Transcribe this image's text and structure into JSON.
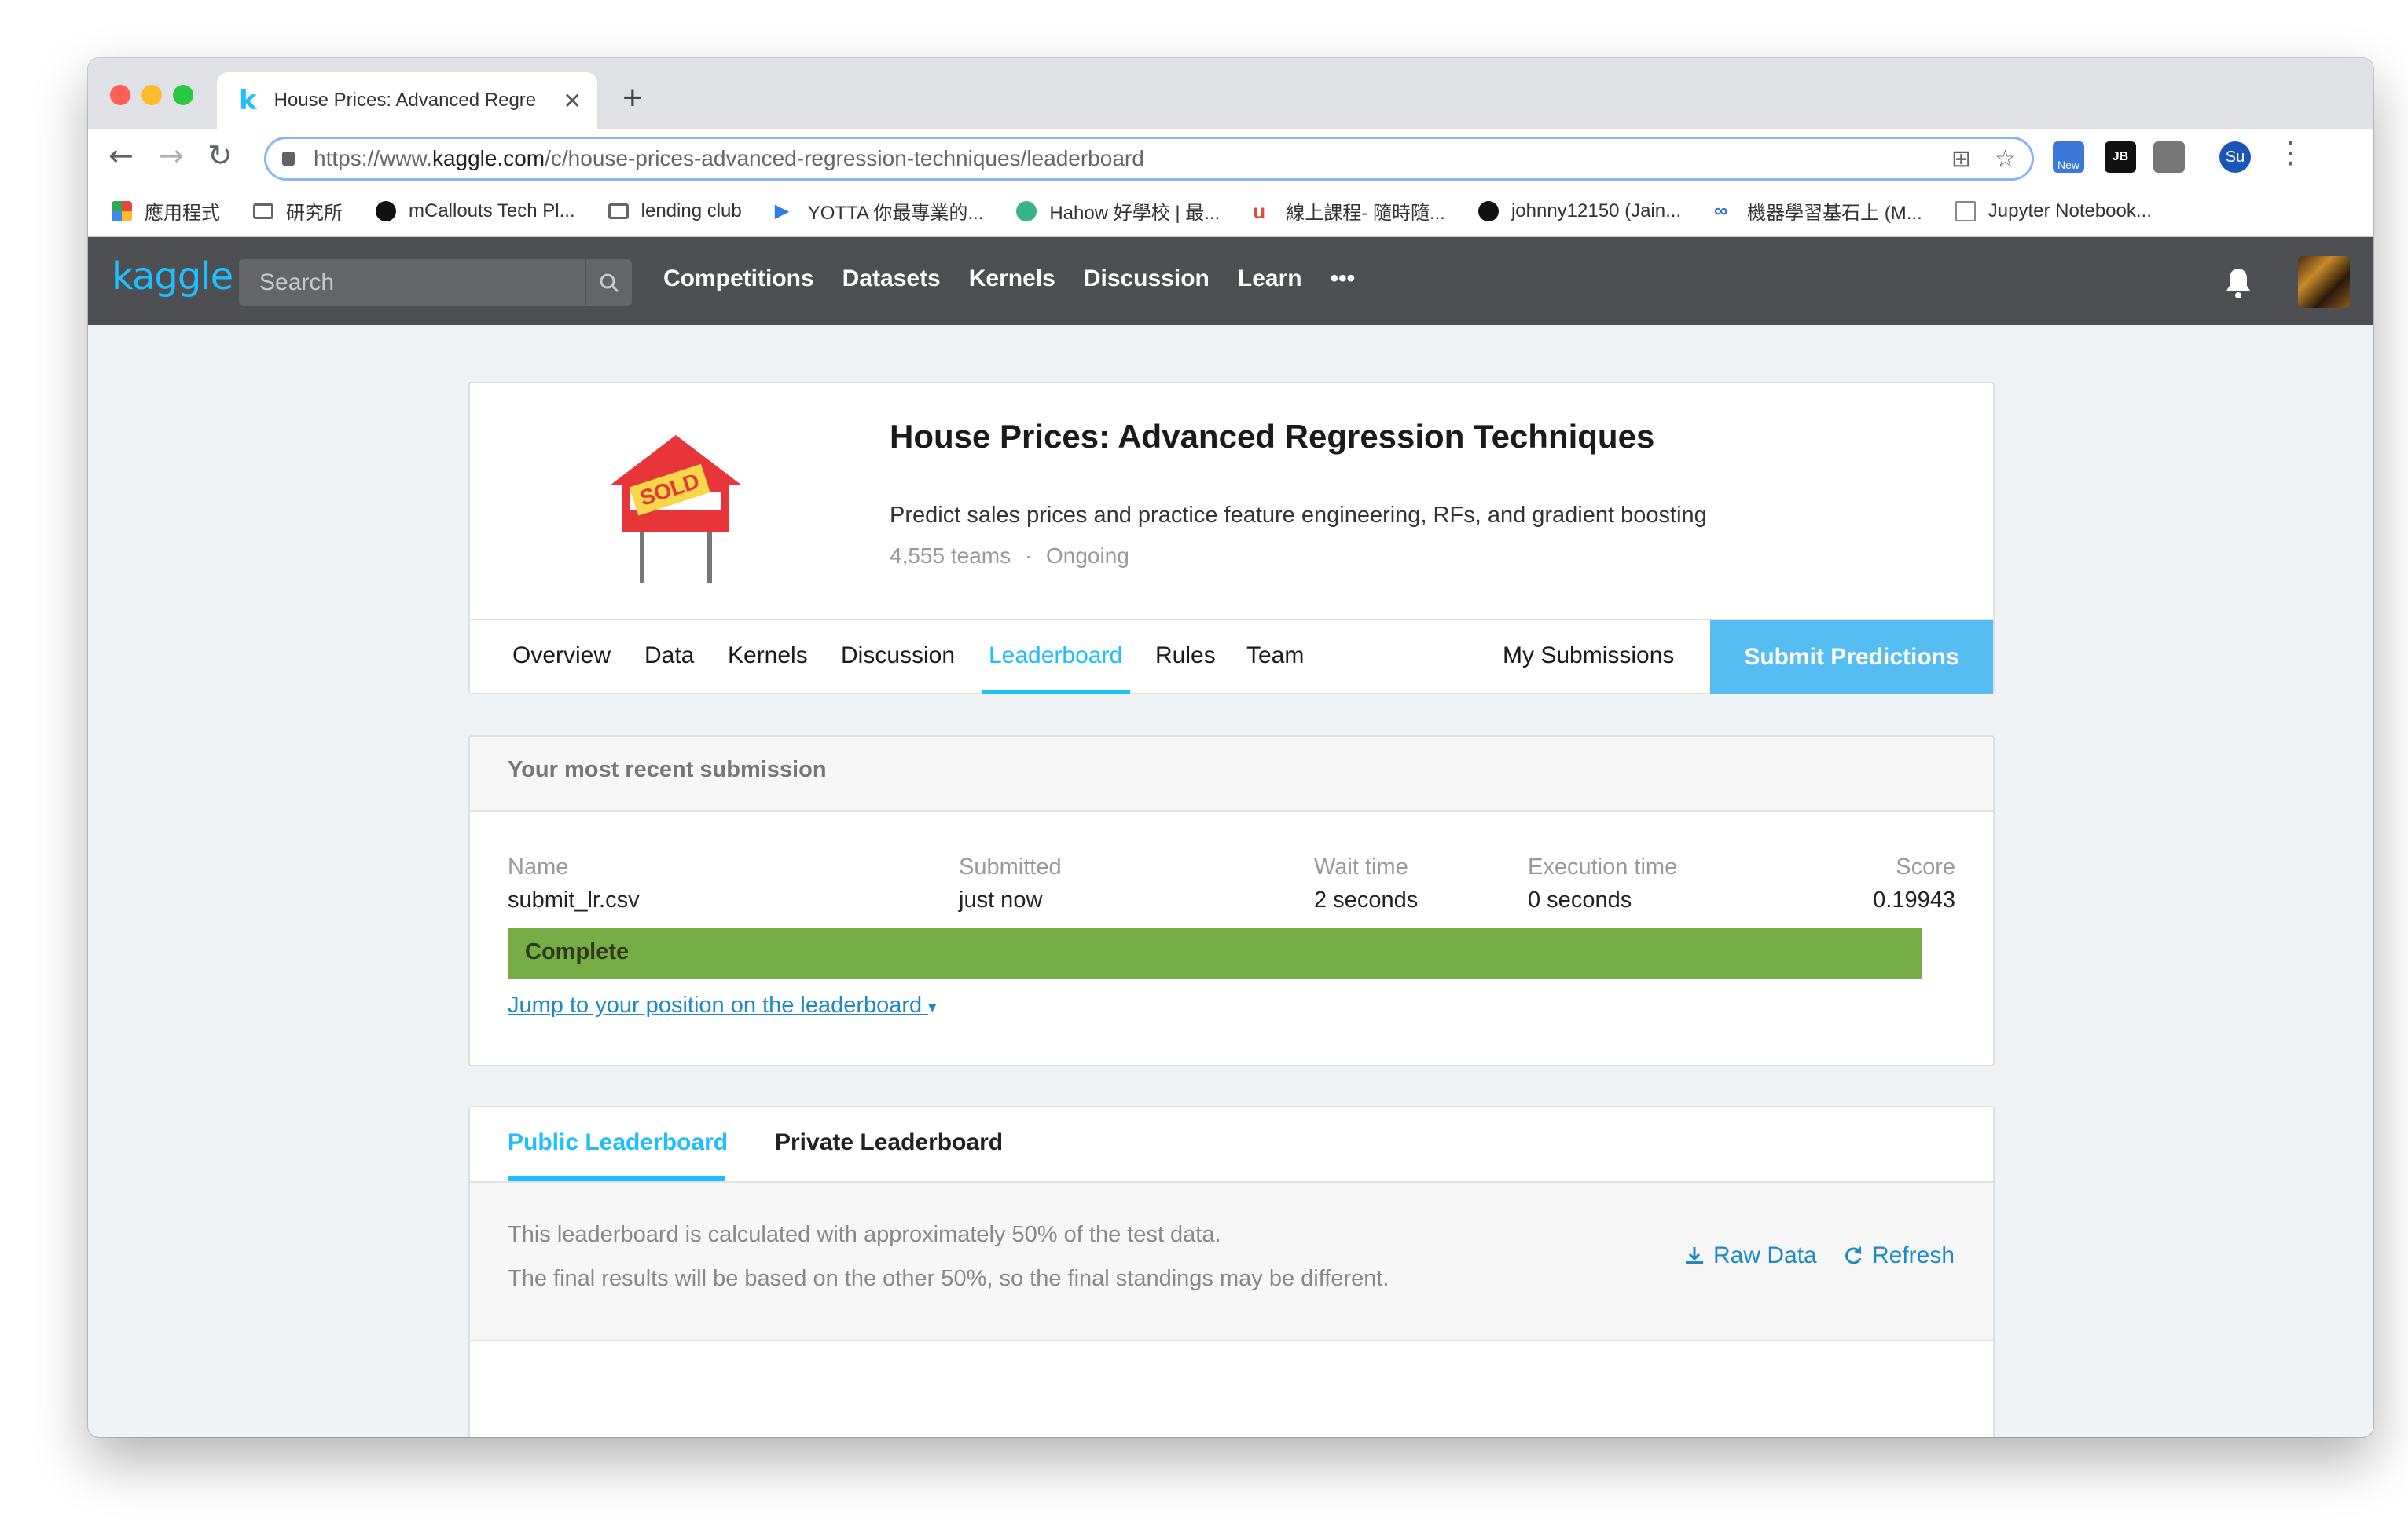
{
  "browser": {
    "tab_title": "House Prices: Advanced Regre",
    "tab_favicon": "k",
    "url_prefix": "https://www.",
    "url_domain": "kaggle.com",
    "url_path": "/c/house-prices-advanced-regression-techniques/leaderboard",
    "ext_new_badge": "New",
    "profile_initials": "Su"
  },
  "bookmarks": [
    {
      "label": "應用程式",
      "icon": "apps-grid-icon",
      "color": "#e8453c"
    },
    {
      "label": "研究所",
      "icon": "folder-icon",
      "color": "#666666"
    },
    {
      "label": "mCallouts Tech Pl...",
      "icon": "medium-icon",
      "color": "#111111"
    },
    {
      "label": "lending club",
      "icon": "folder-icon",
      "color": "#666666"
    },
    {
      "label": "YOTTA 你最專業的...",
      "icon": "play-icon",
      "color": "#2e7de1"
    },
    {
      "label": "Hahow 好學校 | 最...",
      "icon": "hahow-icon",
      "color": "#38b48b"
    },
    {
      "label": "線上課程- 隨時隨...",
      "icon": "udemy-icon",
      "color": "#e04e39"
    },
    {
      "label": "johnny12150 (Jain...",
      "icon": "github-icon",
      "color": "#111111"
    },
    {
      "label": "機器學習基石上 (M...",
      "icon": "coursera-icon",
      "color": "#2a73cc"
    },
    {
      "label": "Jupyter Notebook...",
      "icon": "jupyter-icon",
      "color": "#888888"
    }
  ],
  "kaggle": {
    "logo": "kaggle",
    "search_placeholder": "Search",
    "nav": [
      "Competitions",
      "Datasets",
      "Kernels",
      "Discussion",
      "Learn"
    ],
    "more": "•••"
  },
  "competition": {
    "title": "House Prices: Advanced Regression Techniques",
    "description": "Predict sales prices and practice feature engineering, RFs, and gradient boosting",
    "teams": "4,555 teams",
    "separator": "·",
    "status": "Ongoing",
    "sign_text": "SOLD",
    "tabs": [
      "Overview",
      "Data",
      "Kernels",
      "Discussion",
      "Leaderboard",
      "Rules",
      "Team"
    ],
    "active_tab": "Leaderboard",
    "my_submissions": "My Submissions",
    "submit_button": "Submit Predictions"
  },
  "recent_submission": {
    "heading": "Your most recent submission",
    "labels": {
      "name": "Name",
      "submitted": "Submitted",
      "wait": "Wait time",
      "exec": "Execution time",
      "score": "Score"
    },
    "values": {
      "name": "submit_lr.csv",
      "submitted": "just now",
      "wait": "2 seconds",
      "exec": "0 seconds",
      "score": "0.19943"
    },
    "status": "Complete",
    "jump_link": "Jump to your position on the leaderboard"
  },
  "leaderboard": {
    "tabs": [
      "Public Leaderboard",
      "Private Leaderboard"
    ],
    "active_tab": "Public Leaderboard",
    "info_line1": "This leaderboard is calculated with approximately 50% of the test data.",
    "info_line2": "The final results will be based on the other 50%, so the final standings may be different.",
    "raw_data": "Raw Data",
    "refresh": "Refresh"
  },
  "colors": {
    "kaggle_blue": "#20beff",
    "complete_green": "#76ad45",
    "header_bg": "#4d4f52",
    "link_blue": "#1e88c7"
  }
}
